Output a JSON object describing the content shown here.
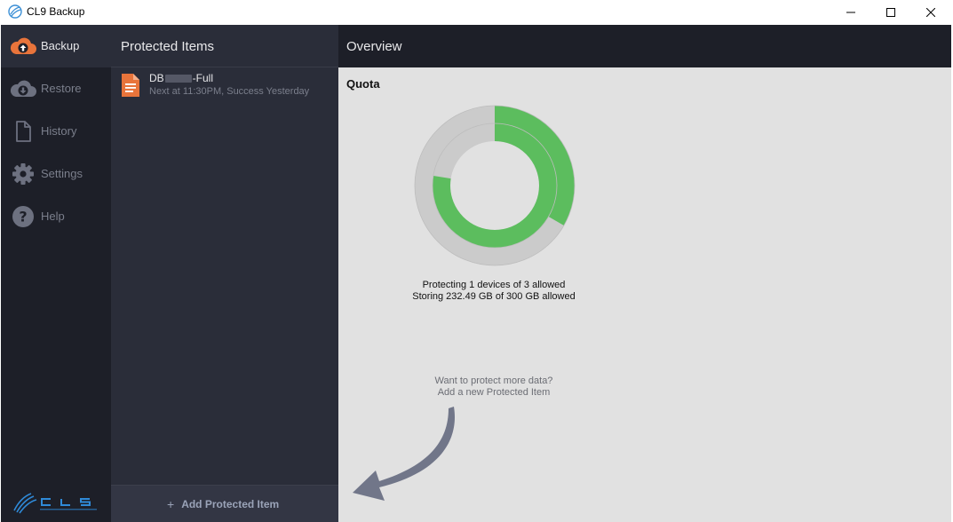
{
  "window": {
    "title": "CL9 Backup",
    "controls": [
      "minimize",
      "maximize",
      "close"
    ]
  },
  "nav": {
    "items": [
      {
        "label": "Backup",
        "icon": "cloud-upload-icon",
        "active": true
      },
      {
        "label": "Restore",
        "icon": "cloud-download-icon",
        "active": false
      },
      {
        "label": "History",
        "icon": "document-icon",
        "active": false
      },
      {
        "label": "Settings",
        "icon": "gear-icon",
        "active": false
      },
      {
        "label": "Help",
        "icon": "question-icon",
        "active": false
      }
    ]
  },
  "protected_items": {
    "title": "Protected Items",
    "items": [
      {
        "name_prefix": "DB",
        "name_suffix": "-Full",
        "status": "Next at 11:30PM, Success Yesterday",
        "icon": "file-icon"
      }
    ],
    "add_label": "Add Protected Item"
  },
  "overview": {
    "title": "Overview",
    "quota": {
      "label": "Quota",
      "devices_used": 1,
      "devices_allowed": 3,
      "storage_used_gb": 232.49,
      "storage_allowed_gb": 300,
      "devices_text": "Protecting 1 devices of 3 allowed",
      "storage_text": "Storing 232.49 GB of 300 GB allowed"
    },
    "hint": {
      "line1": "Want to protect more data?",
      "line2": "Add a new Protected Item"
    }
  },
  "colors": {
    "nav_bg": "#1d1f28",
    "panel_bg": "#2a2d39",
    "overview_bg": "#e1e1e1",
    "quota_fill": "#5cbd5e",
    "quota_track": "#cbcbcb",
    "accent_orange": "#e8743b"
  }
}
